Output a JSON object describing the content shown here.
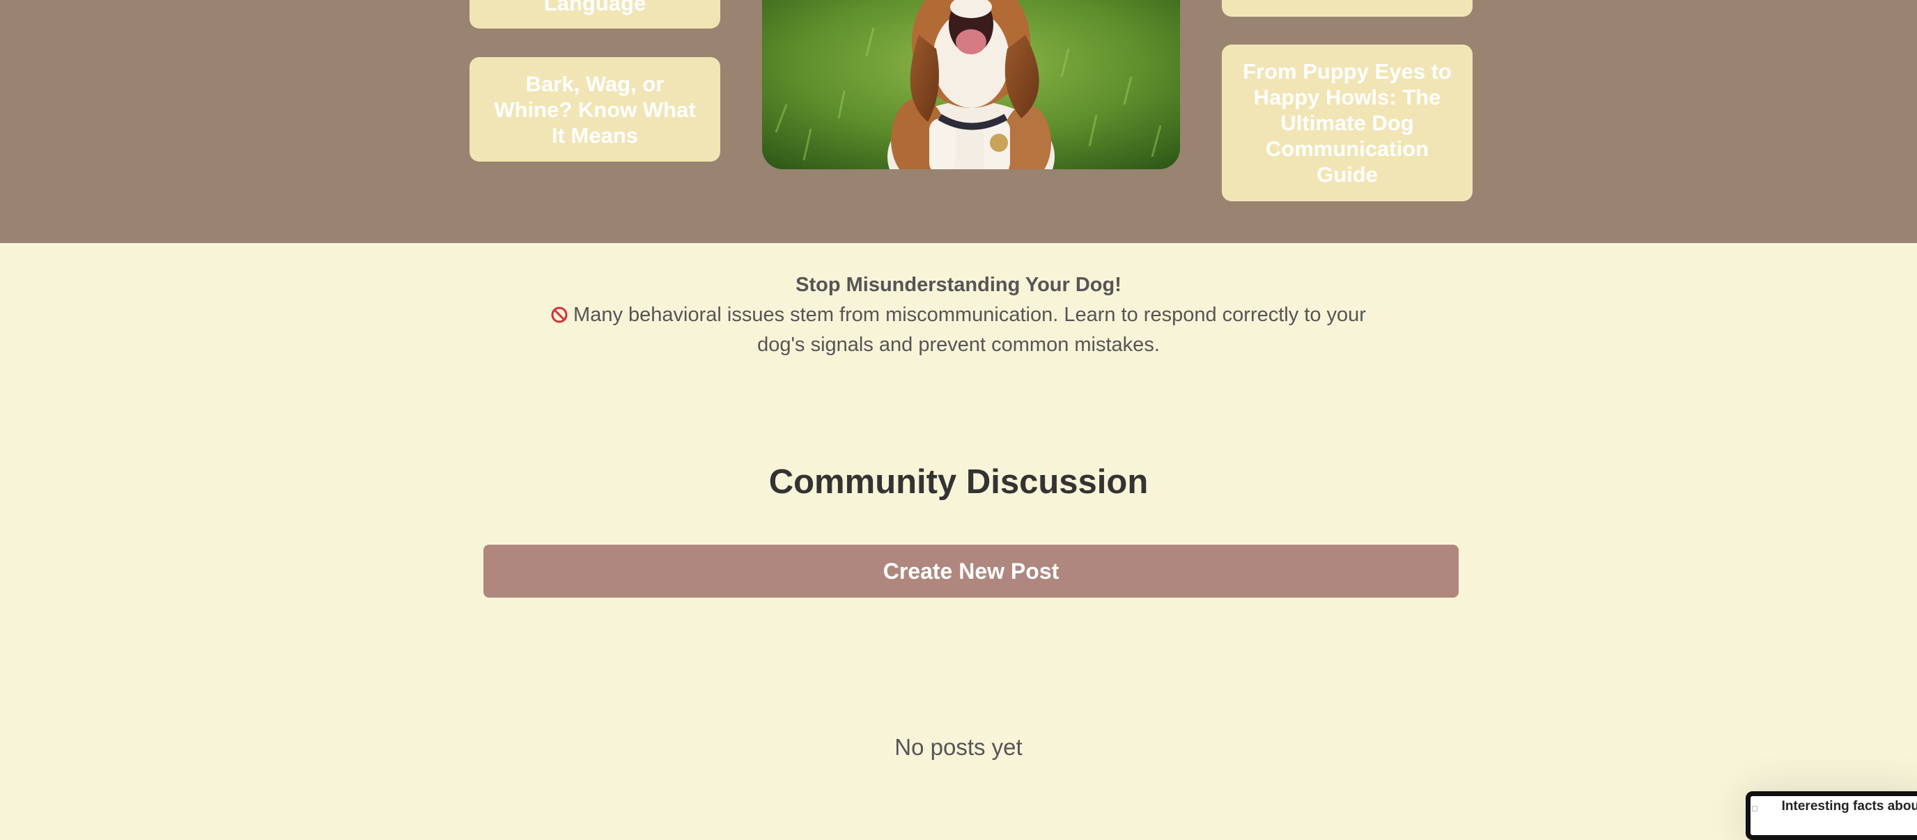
{
  "hero": {
    "left_cards": [
      {
        "label": "Language"
      },
      {
        "label": "Bark, Wag, or Whine? Know What It Means"
      }
    ],
    "right_cards": [
      {
        "label": ""
      },
      {
        "label": "From Puppy Eyes to Happy Howls: The Ultimate Dog Communication Guide"
      }
    ],
    "image_subject": "beagle-howling-photo"
  },
  "notice": {
    "title": "Stop Misunderstanding Your Dog!",
    "icon": "no-entry-icon",
    "body": "Many behavioral issues stem from miscommunication. Learn to respond correctly to your dog's signals and prevent common mistakes."
  },
  "community": {
    "title": "Community Discussion",
    "create_label": "Create New Post",
    "empty_text": "No posts yet"
  },
  "facts_widget": {
    "label": "Interesting facts about Facts"
  },
  "colors": {
    "hero_bg": "#998371",
    "card_bg": "#f1e5b5",
    "page_bg": "#f8f4d8",
    "button_bg": "#af877f"
  }
}
